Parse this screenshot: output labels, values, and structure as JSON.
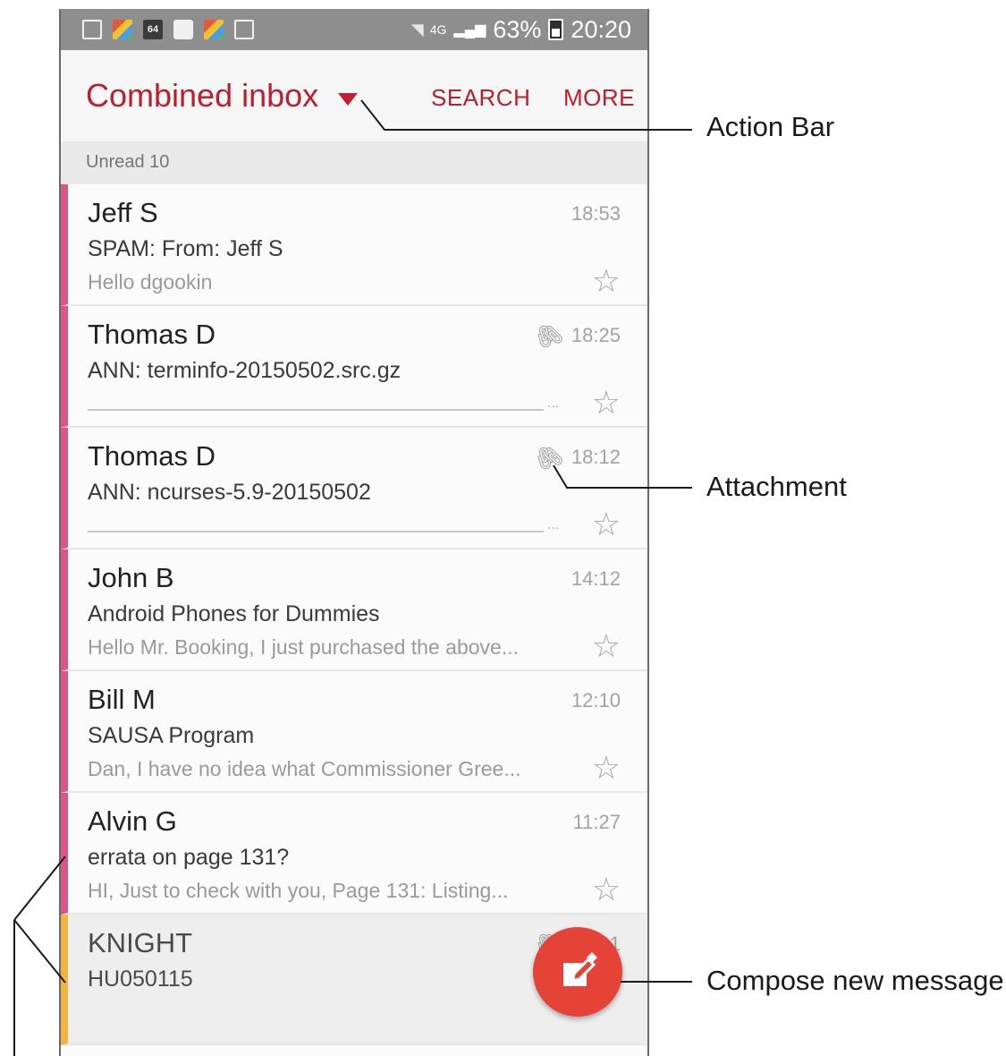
{
  "status_bar": {
    "notification_icons": [
      "gallery-icon",
      "app-icon",
      "badge-64-icon",
      "chat-icon",
      "app-icon",
      "inbox-tray-icon"
    ],
    "badge_text": "64",
    "network": "4G",
    "battery": "63%",
    "time": "20:20"
  },
  "action_bar": {
    "title": "Combined inbox",
    "search_label": "SEARCH",
    "more_label": "MORE"
  },
  "unread": {
    "label": "Unread 10"
  },
  "messages": [
    {
      "sender": "Jeff S",
      "subject": "SPAM: From: Jeff S",
      "preview": "Hello dgookin",
      "time": "18:53",
      "attachment": false
    },
    {
      "sender": "Thomas D",
      "subject": "ANN: terminfo-20150502.src.gz",
      "preview": "",
      "time": "18:25",
      "attachment": true
    },
    {
      "sender": "Thomas D",
      "subject": "ANN: ncurses-5.9-20150502",
      "preview": "",
      "time": "18:12",
      "attachment": true
    },
    {
      "sender": "John B",
      "subject": "Android Phones for Dummies",
      "preview": "Hello Mr. Booking, I just purchased the above...",
      "time": "14:12",
      "attachment": false
    },
    {
      "sender": "Bill M",
      "subject": "SAUSA Program",
      "preview": "Dan, I have no idea what Commissioner Gree...",
      "time": "12:10",
      "attachment": false
    },
    {
      "sender": "Alvin G",
      "subject": "errata on page 131?",
      "preview": "HI,  Just to check with you,  Page 131: Listing...",
      "time": "11:27",
      "attachment": false
    },
    {
      "sender": "KNIGHT",
      "subject": "HU050115",
      "preview": "",
      "time": "01",
      "attachment": true
    }
  ],
  "callouts": {
    "action_bar": "Action Bar",
    "attachment": "Attachment",
    "compose": "Compose new message"
  },
  "colors": {
    "accent_red": "#b8202f",
    "compose_fab": "#e64338",
    "unread_marker": "#d9558a",
    "account_marker": "#f2b440"
  }
}
